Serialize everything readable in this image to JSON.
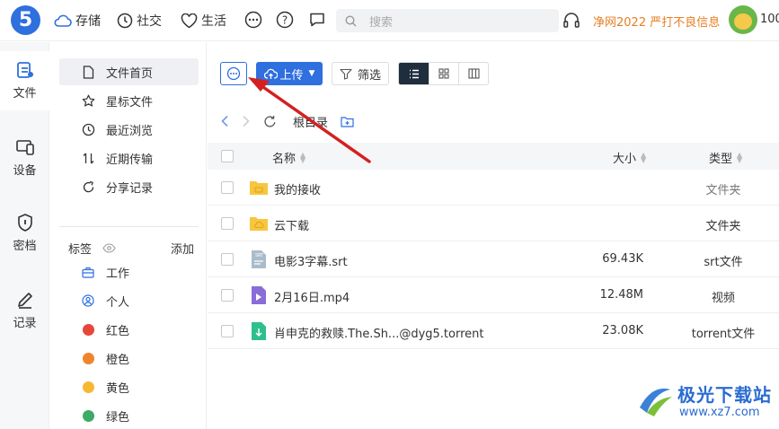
{
  "topbar": {
    "logo_text": "5",
    "nav": [
      {
        "label": "存储",
        "icon": "cloud-icon"
      },
      {
        "label": "社交",
        "icon": "clock-icon"
      },
      {
        "label": "生活",
        "icon": "heart-icon"
      }
    ],
    "search_placeholder": "搜索",
    "notice": "净网2022 严打不良信息",
    "user_partial": "100"
  },
  "rail": {
    "items": [
      {
        "label": "文件",
        "icon": "file-icon",
        "active": true
      },
      {
        "label": "设备",
        "icon": "device-icon"
      },
      {
        "label": "密档",
        "icon": "shield-icon"
      },
      {
        "label": "记录",
        "icon": "pen-icon"
      }
    ]
  },
  "sidebar": {
    "items": [
      {
        "label": "文件首页",
        "icon": "document-icon",
        "active": true
      },
      {
        "label": "星标文件",
        "icon": "star-icon"
      },
      {
        "label": "最近浏览",
        "icon": "history-icon"
      },
      {
        "label": "近期传输",
        "icon": "transfer-icon"
      },
      {
        "label": "分享记录",
        "icon": "share-icon"
      }
    ],
    "tags_label": "标签",
    "tags_add": "添加",
    "tags": [
      {
        "label": "工作",
        "icon": "briefcase-icon"
      },
      {
        "label": "个人",
        "icon": "person-icon"
      },
      {
        "label": "红色",
        "color": "#e8463a"
      },
      {
        "label": "橙色",
        "color": "#f0842b"
      },
      {
        "label": "黄色",
        "color": "#f7b731"
      },
      {
        "label": "绿色",
        "color": "#3bab67"
      }
    ]
  },
  "toolbar": {
    "upload_label": "上传",
    "filter_label": "筛选"
  },
  "breadcrumb": {
    "root": "根目录"
  },
  "table": {
    "headers": {
      "name": "名称",
      "size": "大小",
      "type": "类型"
    },
    "rows": [
      {
        "name": "我的接收",
        "size": "",
        "type": "文件夹",
        "kind": "folder-receive"
      },
      {
        "name": "云下载",
        "size": "",
        "type": "文件夹",
        "kind": "folder-cloud"
      },
      {
        "name": "电影3字幕.srt",
        "size": "69.43K",
        "type": "srt文件",
        "kind": "srt"
      },
      {
        "name": "2月16日.mp4",
        "size": "12.48M",
        "type": "视频",
        "kind": "video"
      },
      {
        "name": "肖申克的救赎.The.Sh...@dyg5.torrent",
        "size": "23.08K",
        "type": "torrent文件",
        "kind": "torrent"
      }
    ]
  },
  "watermark": {
    "name": "极光下载站",
    "url": "www.xz7.com"
  },
  "colors": {
    "brand": "#2f6fde",
    "annotation_arrow": "#d42020"
  }
}
